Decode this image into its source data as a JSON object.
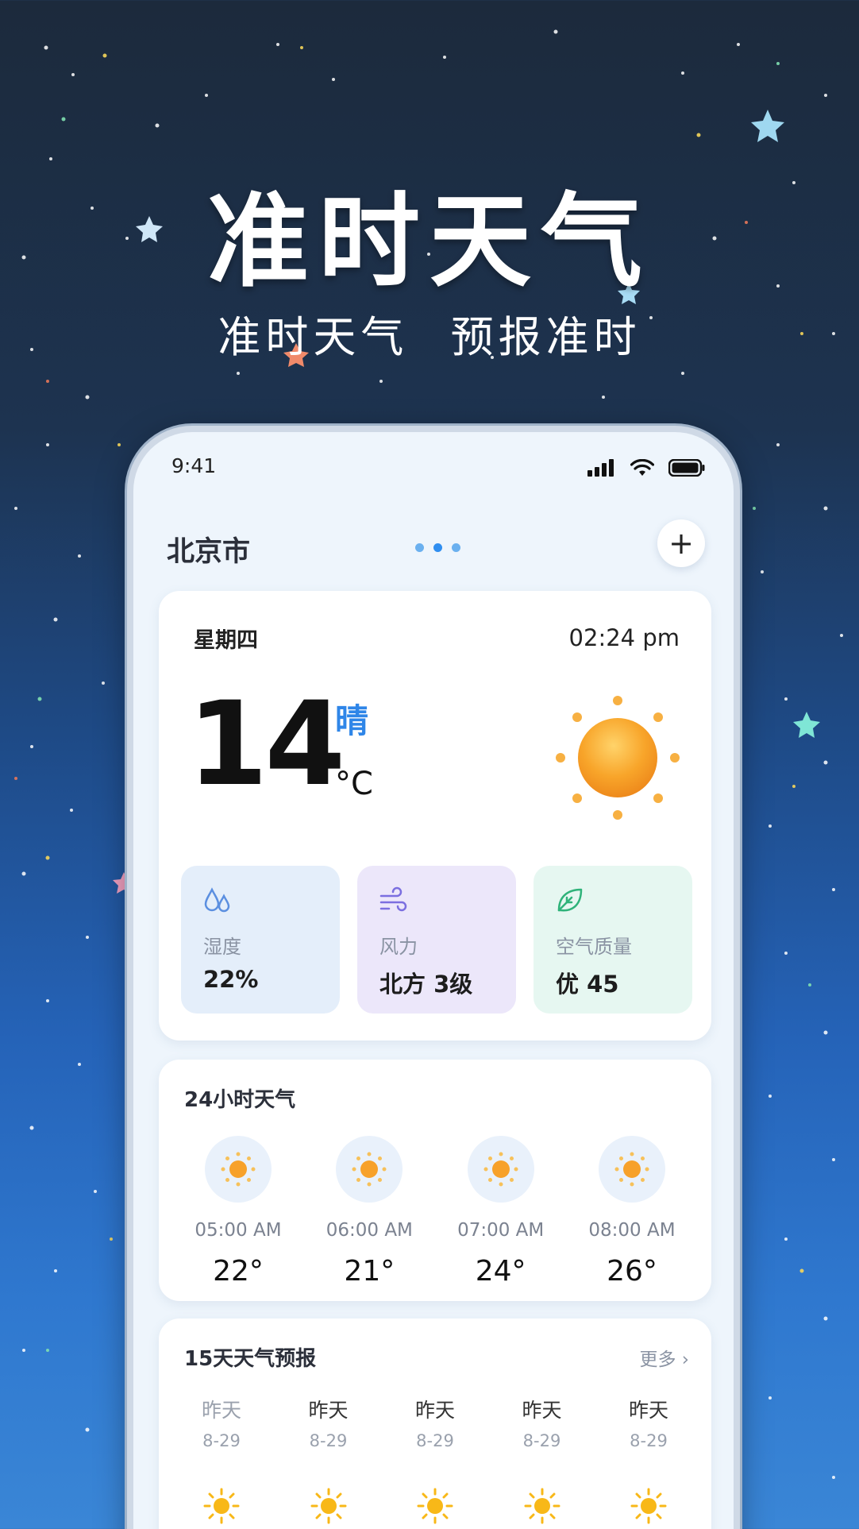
{
  "promo": {
    "title": "准时天气",
    "subtitle": "准时天气 预报准时"
  },
  "status_bar": {
    "time": "9:41"
  },
  "header": {
    "city": "北京市",
    "add_label": "+"
  },
  "current": {
    "weekday": "星期四",
    "time": "02:24 pm",
    "temperature": "14",
    "unit": "°C",
    "condition": "晴",
    "icon": "sun-icon"
  },
  "metrics": [
    {
      "label": "湿度",
      "value": "22%",
      "icon": "humidity-icon",
      "color": "#e4eefa"
    },
    {
      "label": "风力",
      "value": "北方 3级",
      "icon": "wind-icon",
      "color": "#ece7fa"
    },
    {
      "label": "空气质量",
      "value": "优 45",
      "icon": "leaf-icon",
      "color": "#e6f7f1"
    }
  ],
  "hourly": {
    "title": "24小时天气",
    "items": [
      {
        "time": "05:00 AM",
        "temp": "22°",
        "icon": "sun-icon"
      },
      {
        "time": "06:00 AM",
        "temp": "21°",
        "icon": "sun-icon"
      },
      {
        "time": "07:00 AM",
        "temp": "24°",
        "icon": "sun-icon"
      },
      {
        "time": "08:00 AM",
        "temp": "26°",
        "icon": "sun-icon"
      }
    ]
  },
  "daily": {
    "title": "15天天气预报",
    "more": "更多 ›",
    "items": [
      {
        "name": "昨天",
        "date": "8-29",
        "icon": "sun-icon"
      },
      {
        "name": "昨天",
        "date": "8-29",
        "icon": "sun-icon"
      },
      {
        "name": "昨天",
        "date": "8-29",
        "icon": "sun-icon"
      },
      {
        "name": "昨天",
        "date": "8-29",
        "icon": "sun-icon"
      },
      {
        "name": "昨天",
        "date": "8-29",
        "icon": "sun-icon"
      }
    ]
  },
  "colors": {
    "accent": "#2f86e8",
    "sun": "#f5a623"
  }
}
